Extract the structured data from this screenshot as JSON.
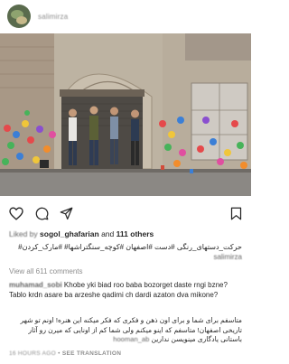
{
  "header": {
    "username": "salimirza"
  },
  "post": {
    "liked_by_prefix": "Liked by",
    "liked_by_user": "sogol_ghafarian",
    "liked_by_middle": "and",
    "liked_by_others": "111 others",
    "caption_user": "salimirza",
    "caption_text": "حرکت_دستهای_رنگی #دست #اصفهان #کوچه_سنگتراشها# #مارک_کردن#",
    "view_all_comments": "View all 611 comments"
  },
  "comments": [
    {
      "user": "muhamad_sobi",
      "text": "Khobe yki biad roo baba bozorget daste rngi bzne? Tablo krdn asare ba arzeshe qadimi ch dardi azaton dva mikone?"
    },
    {
      "user": "hooman_ab",
      "text": "متاسفم برای شما و برای اون ذهن و فکری که فکر میکنه این هنره! اونم تو شهر تاریخی اصفهان! متاسفم که اینو میکنم ولی شما کم از اونایی که میرن رو آثار باستانی یادگاری مینویسن ندارین"
    }
  ],
  "footer": {
    "time": "16 HOURS AGO",
    "separator": "•",
    "translate": "SEE TRANSLATION"
  },
  "icons": {
    "like": "heart-outline-icon",
    "comment": "comment-bubble-icon",
    "share": "paper-plane-icon",
    "save": "bookmark-icon"
  }
}
